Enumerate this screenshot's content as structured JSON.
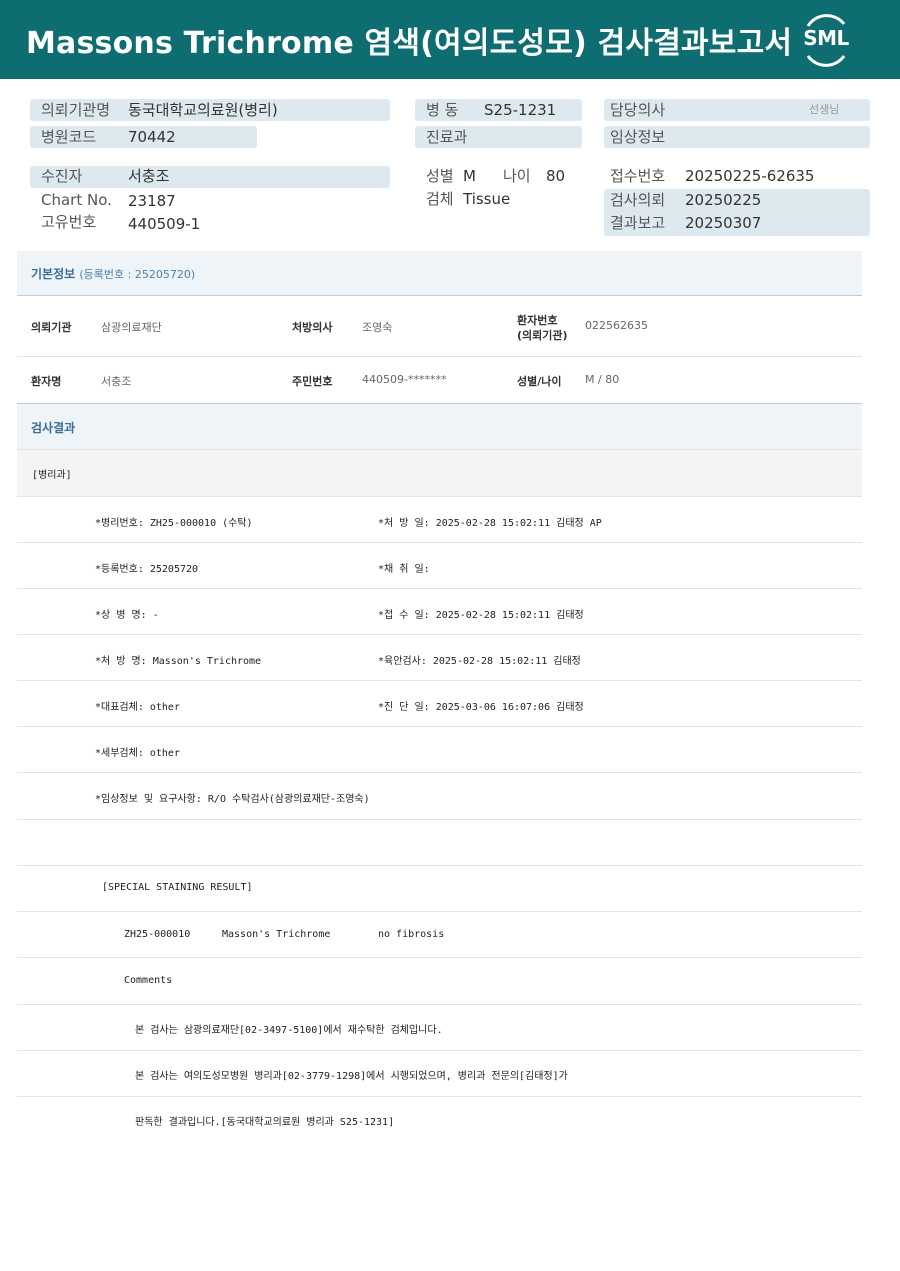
{
  "header": {
    "title": "Massons  Trichrome 염색(여의도성모) 검사결과보고서",
    "logo": "SML"
  },
  "top_info": {
    "institution_label": "의뢰기관명",
    "institution_value": "동국대학교의료원(병리)",
    "hospital_code_label": "병원코드",
    "hospital_code_value": "70442",
    "ward_label": "병  동",
    "ward_value": "S25-1231",
    "dept_label": "진료과",
    "doctor_label": "담당의사",
    "doctor_suffix": "선생님",
    "clinical_label": "임상정보",
    "patient_label": "수진자",
    "patient_value": "서충조",
    "chart_label": "Chart No.",
    "chart_value": "23187",
    "unique_label": "고유번호",
    "unique_value": "440509-1",
    "sex_label": "성별",
    "sex_value": "M",
    "age_label": "나이",
    "age_value": "80",
    "specimen_label": "검체",
    "specimen_value": "Tissue",
    "receipt_label": "접수번호",
    "receipt_value": "20250225-62635",
    "request_label": "검사의뢰",
    "request_value": "20250225",
    "report_label": "결과보고",
    "report_value": "20250307"
  },
  "basic": {
    "title": "기본정보",
    "reg": "(등록번호 : 25205720)",
    "row1": {
      "k1": "의뢰기관",
      "v1": "삼광의료재단",
      "k2": "처방의사",
      "v2": "조영숙",
      "k3a": "환자번호",
      "k3b": "(의뢰기관)",
      "v3": "022562635"
    },
    "row2": {
      "k1": "환자명",
      "v1": "서충조",
      "k2": "주민번호",
      "v2": "440509-*******",
      "k3": "성별/나이",
      "v3": "M / 80"
    }
  },
  "result": {
    "title": "검사결과",
    "dept": "[병리과]",
    "lines": [
      {
        "left": "*병리번호: ZH25-000010 (수탁)",
        "right": "*처 방 일: 2025-02-28 15:02:11  김태정 AP"
      },
      {
        "left": "*등록번호: 25205720",
        "right": "*채 취 일:"
      },
      {
        "left": "*상 병 명: -",
        "right": "*접 수 일: 2025-02-28 15:02:11  김태정"
      },
      {
        "left": "*처 방 명: Masson's Trichrome",
        "right": "*육안검사: 2025-02-28 15:02:11  김태정"
      },
      {
        "left": "*대표검체: other",
        "right": "*진 단 일: 2025-03-06 16:07:06  김태정"
      },
      {
        "left": "*세부검체: other",
        "right": ""
      },
      {
        "left": "*임상정보 및 요구사항: R/O 수탁검사(삼광의료재단-조영숙)",
        "right": ""
      }
    ],
    "special_title": "[SPECIAL STAINING RESULT]",
    "special_id": "ZH25-000010",
    "special_test": "Masson's Trichrome",
    "special_result": "no fibrosis",
    "comments_label": "Comments",
    "comment1": "본 검사는 삼광의료재단[02-3497-5100]에서 재수탁한 검체입니다.",
    "comment2": "본 검사는 여의도성모병원 병리과[02-3779-1298]에서 시행되었으며, 병리과 전문의[김태정]가",
    "comment3": "판독한 결과입니다.[동국대학교의료원 병리과 S25-1231]"
  }
}
